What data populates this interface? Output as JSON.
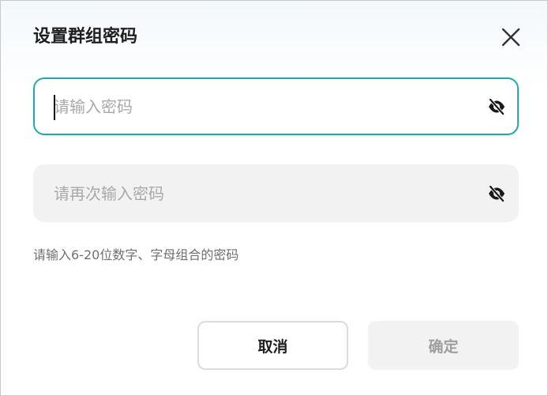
{
  "dialog": {
    "title": "设置群组密码",
    "close_icon": "close-icon"
  },
  "password": {
    "placeholder": "请输入密码",
    "value": "",
    "visibility_icon": "eye-off-icon",
    "focused": true
  },
  "confirm_password": {
    "placeholder": "请再次输入密码",
    "value": "",
    "visibility_icon": "eye-off-icon"
  },
  "hint": "请输入6-20位数字、字母组合的密码",
  "buttons": {
    "cancel_label": "取消",
    "confirm_label": "确定",
    "confirm_enabled": false
  },
  "colors": {
    "accent": "#22a9ac",
    "field_fill": "#f2f2f2",
    "disabled_text": "#9e9e9e"
  }
}
